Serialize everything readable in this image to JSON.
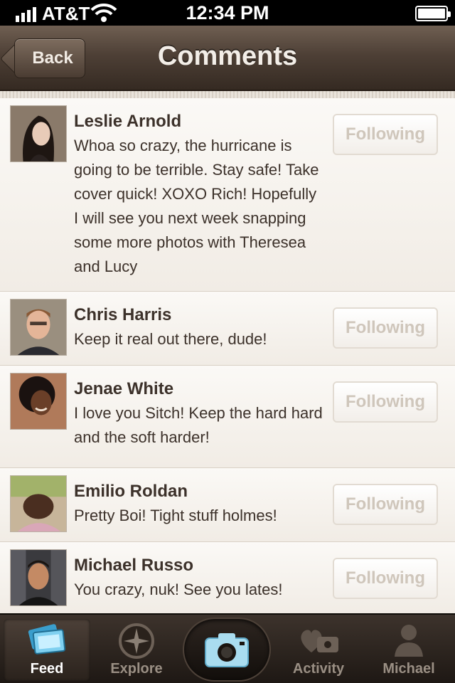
{
  "status_bar": {
    "carrier": "AT&T",
    "time": "12:34 PM"
  },
  "nav": {
    "back_label": "Back",
    "title": "Comments"
  },
  "comments": [
    {
      "name": "Leslie Arnold",
      "text": "Whoa so crazy, the hurricane is going to be terrible. Stay safe! Take cover quick! XOXO Rich! Hopefully I will see you next week snapping some more photos with Theresea and Lucy",
      "follow_label": "Following"
    },
    {
      "name": "Chris Harris",
      "text": "Keep it real out there, dude!",
      "follow_label": "Following"
    },
    {
      "name": "Jenae White",
      "text": "I love you Sitch! Keep the hard hard and the soft harder!",
      "follow_label": "Following"
    },
    {
      "name": "Emilio Roldan",
      "text": "Pretty Boi! Tight stuff holmes!",
      "follow_label": "Following"
    },
    {
      "name": "Michael Russo",
      "text": "You crazy, nuk! See you lates!",
      "follow_label": "Following"
    }
  ],
  "tabs": [
    {
      "label": "Feed",
      "icon": "feed-icon",
      "active": true
    },
    {
      "label": "Explore",
      "icon": "compass-icon"
    },
    {
      "label": "",
      "icon": "camera-icon"
    },
    {
      "label": "Activity",
      "icon": "activity-icon"
    },
    {
      "label": "Michael",
      "icon": "profile-icon"
    }
  ],
  "colors": {
    "nav_bg": "#4e4036",
    "tab_bg": "#2a221c",
    "text": "#3c312a",
    "follow_text": "#cfc6bb",
    "camera_blue": "#9fd3ea"
  }
}
